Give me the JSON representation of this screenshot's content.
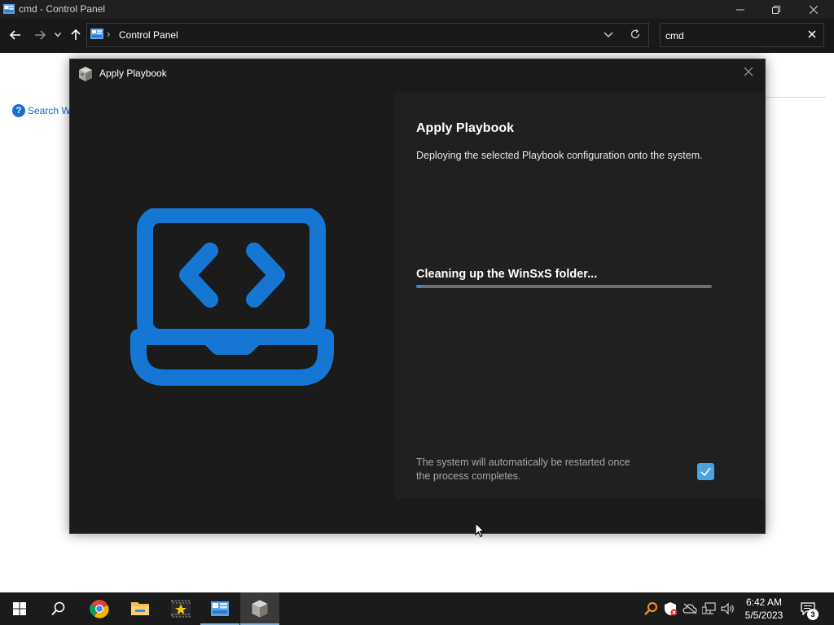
{
  "explorer": {
    "window_title": "cmd - Control Panel",
    "address": "Control Panel",
    "search_query": "cmd",
    "search_windows_link": "Search Wi"
  },
  "dialog": {
    "title": "Apply Playbook",
    "heading": "Apply Playbook",
    "description": "Deploying the selected Playbook configuration onto the system.",
    "progress_status": "Cleaning up the WinSxS folder...",
    "progress_fraction": 0.02,
    "restart_note": "The system will automatically be restarted once the process completes.",
    "restart_checked": true
  },
  "taskbar": {
    "clock_time": "6:42 AM",
    "clock_date": "5/5/2023",
    "notification_count": "3",
    "items": [
      "start",
      "search",
      "chrome",
      "file-explorer",
      "imdb-app",
      "control-panel",
      "playbook-app"
    ]
  },
  "colors": {
    "accent": "#2f8bd6",
    "hero_blue": "#1577d3",
    "dialog_bg": "#1b1b1b",
    "panel_bg": "#202020",
    "taskbar_bg": "#1b1b1b"
  }
}
